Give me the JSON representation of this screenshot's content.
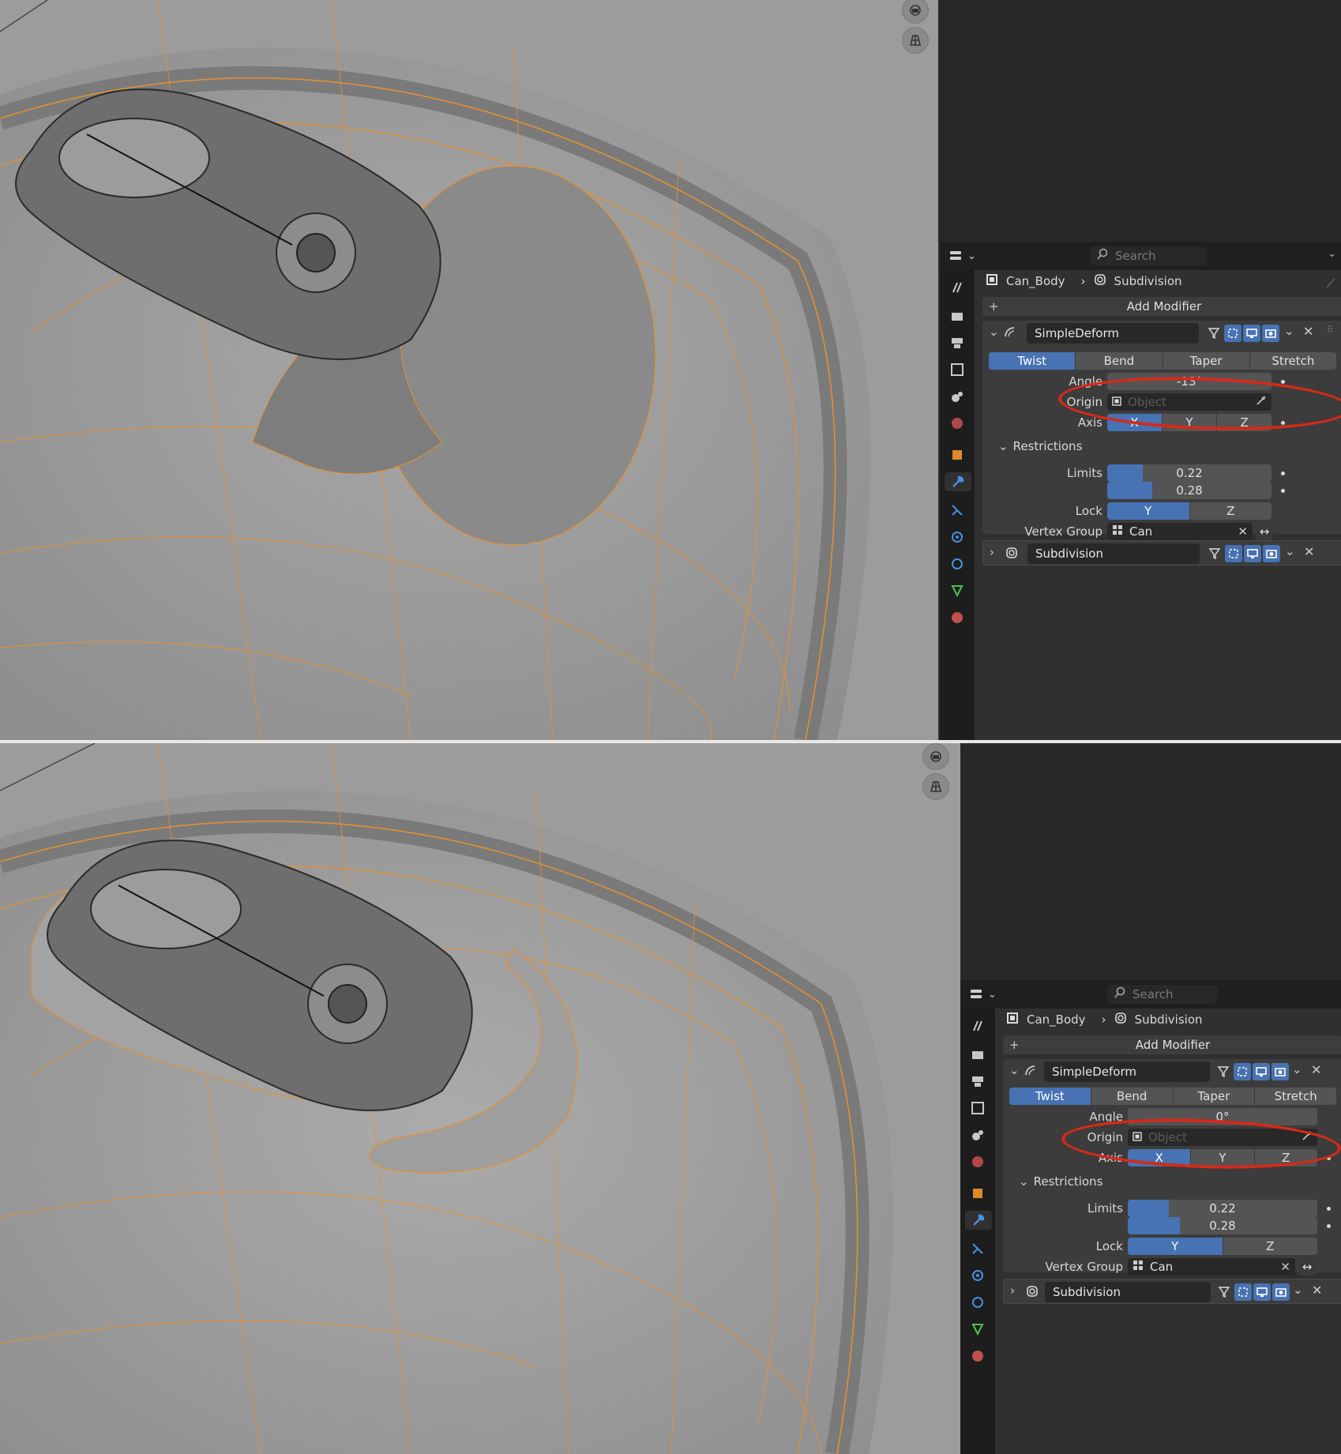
{
  "top": {
    "breadcrumb": {
      "object": "Can_Body",
      "modifier": "Subdivision"
    },
    "search": {
      "placeholder": "Search"
    },
    "add_modifier": "Add Modifier",
    "modifier1": {
      "name": "SimpleDeform",
      "modes": [
        "Twist",
        "Bend",
        "Taper",
        "Stretch"
      ],
      "selected_mode": "Twist",
      "angle_label": "Angle",
      "angle_value": "-13°",
      "origin_label": "Origin",
      "origin_placeholder": "Object",
      "axis_label": "Axis",
      "axis_options": [
        "X",
        "Y",
        "Z"
      ],
      "axis_selected": "X",
      "restrictions_label": "Restrictions",
      "limits_label": "Limits",
      "limit_min": "0.22",
      "limit_max": "0.28",
      "limit_min_fraction": 0.22,
      "limit_max_fraction": 0.28,
      "lock_label": "Lock",
      "lock_options": [
        "Y",
        "Z"
      ],
      "lock_selected": "Y",
      "vertex_group_label": "Vertex Group",
      "vertex_group_value": "Can"
    },
    "modifier2": {
      "name": "Subdivision"
    }
  },
  "bottom": {
    "breadcrumb": {
      "object": "Can_Body",
      "modifier": "Subdivision"
    },
    "search": {
      "placeholder": "Search"
    },
    "add_modifier": "Add Modifier",
    "modifier1": {
      "name": "SimpleDeform",
      "modes": [
        "Twist",
        "Bend",
        "Taper",
        "Stretch"
      ],
      "selected_mode": "Twist",
      "angle_label": "Angle",
      "angle_value": "0°",
      "origin_label": "Origin",
      "origin_placeholder": "Object",
      "axis_label": "Axis",
      "axis_options": [
        "X",
        "Y",
        "Z"
      ],
      "axis_selected": "X",
      "restrictions_label": "Restrictions",
      "limits_label": "Limits",
      "limit_min": "0.22",
      "limit_max": "0.28",
      "limit_min_fraction": 0.22,
      "limit_max_fraction": 0.28,
      "lock_label": "Lock",
      "lock_options": [
        "Y",
        "Z"
      ],
      "lock_selected": "Y",
      "vertex_group_label": "Vertex Group",
      "vertex_group_value": "Can"
    },
    "modifier2": {
      "name": "Subdivision"
    }
  },
  "colors": {
    "accent": "#4772b3",
    "wire": "#e8902e",
    "annotation": "#d42a1a",
    "panel_bg": "#303030",
    "viewport_bg": "#9a9a9a"
  },
  "icons": [
    "camera-view-icon",
    "grid-view-icon",
    "editor-type-icon",
    "search-icon",
    "mesh-object-icon",
    "subdivision-icon",
    "simple-deform-icon",
    "filter-icon",
    "editmode-icon",
    "realtime-icon",
    "render-icon",
    "close-icon",
    "chevron-down-icon",
    "expand-icon",
    "eyedropper-icon",
    "vertex-group-icon",
    "invert-icon",
    "wrench-icon"
  ]
}
